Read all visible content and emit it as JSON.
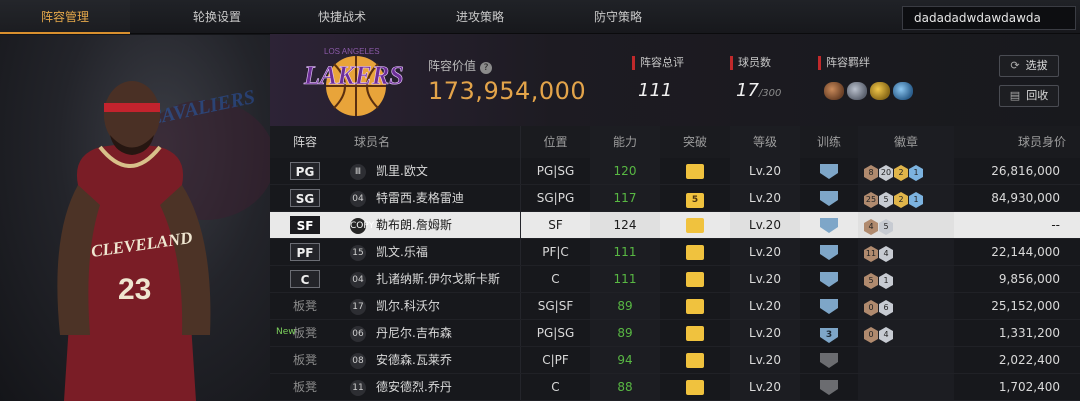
{
  "nav": {
    "tabs": [
      {
        "label": "阵容管理",
        "active": true
      },
      {
        "label": "轮换设置",
        "active": false
      },
      {
        "label": "快捷战术",
        "active": false
      },
      {
        "label": "进攻策略",
        "active": false
      },
      {
        "label": "防守策略",
        "active": false
      }
    ],
    "username": "dadadadwdawdawda"
  },
  "team": {
    "logo_text": "LAKERS",
    "logo_subtext": "LOS ANGELES",
    "value_label": "阵容价值",
    "value": "173,954,000",
    "overall_label": "阵容总评",
    "overall": "111",
    "players_label": "球员数",
    "players_count": "17",
    "players_max": "/300",
    "bond_label": "阵容羁绊",
    "buttons": {
      "select": "选拔",
      "recycle": "回收"
    }
  },
  "featured_player": {
    "team_text": "CLEVELAND",
    "jersey_number": "23",
    "bg_text": "CAVALIERS"
  },
  "table": {
    "headers": {
      "pos": "阵容",
      "name": "球员名",
      "role": "位置",
      "ability": "能力",
      "breakthrough": "突破",
      "level": "等级",
      "training": "训练",
      "badge": "徽章",
      "value": "球员身价"
    },
    "rows": [
      {
        "pos": "PG",
        "bench": false,
        "jersey": "Ⅲ",
        "name": "凯里.欧文",
        "role": "PG|SG",
        "ability": "120",
        "green": true,
        "brk": "",
        "level": "Lv.20",
        "train": "",
        "train_grey": false,
        "badges": [
          [
            "bronze",
            "8"
          ],
          [
            "silver",
            "20"
          ],
          [
            "gold",
            "2"
          ],
          [
            "blue",
            "1"
          ]
        ],
        "value": "26,816,000",
        "selected": false,
        "new": false
      },
      {
        "pos": "SG",
        "bench": false,
        "jersey": "04",
        "name": "特雷西.麦格雷迪",
        "role": "SG|PG",
        "ability": "117",
        "green": true,
        "brk": "5",
        "level": "Lv.20",
        "train": "",
        "train_grey": false,
        "badges": [
          [
            "bronze",
            "25"
          ],
          [
            "silver",
            "5"
          ],
          [
            "gold",
            "2"
          ],
          [
            "blue",
            "1"
          ]
        ],
        "value": "84,930,000",
        "selected": false,
        "new": false
      },
      {
        "pos": "SF",
        "bench": false,
        "jersey": "COPY",
        "name": "勒布朗.詹姆斯",
        "role": "SF",
        "ability": "124",
        "green": false,
        "brk": "",
        "level": "Lv.20",
        "train": "",
        "train_grey": false,
        "badges": [
          [
            "bronze",
            "4"
          ],
          [
            "silver",
            "5"
          ]
        ],
        "value": "--",
        "selected": true,
        "new": false
      },
      {
        "pos": "PF",
        "bench": false,
        "jersey": "15",
        "name": "凯文.乐福",
        "role": "PF|C",
        "ability": "111",
        "green": true,
        "brk": "",
        "level": "Lv.20",
        "train": "",
        "train_grey": false,
        "badges": [
          [
            "bronze",
            "11"
          ],
          [
            "silver",
            "4"
          ]
        ],
        "value": "22,144,000",
        "selected": false,
        "new": false
      },
      {
        "pos": "C",
        "bench": false,
        "jersey": "04",
        "name": "扎诸纳斯.伊尔戈斯卡斯",
        "role": "C",
        "ability": "111",
        "green": true,
        "brk": "",
        "level": "Lv.20",
        "train": "",
        "train_grey": false,
        "badges": [
          [
            "bronze",
            "5"
          ],
          [
            "silver",
            "1"
          ]
        ],
        "value": "9,856,000",
        "selected": false,
        "new": false
      },
      {
        "pos": "板凳",
        "bench": true,
        "jersey": "17",
        "name": "凯尔.科沃尔",
        "role": "SG|SF",
        "ability": "89",
        "green": true,
        "brk": "",
        "level": "Lv.20",
        "train": "",
        "train_grey": false,
        "badges": [
          [
            "bronze",
            "0"
          ],
          [
            "silver",
            "6"
          ]
        ],
        "value": "25,152,000",
        "selected": false,
        "new": false
      },
      {
        "pos": "板凳",
        "bench": true,
        "jersey": "06",
        "name": "丹尼尔.吉布森",
        "role": "PG|SG",
        "ability": "89",
        "green": true,
        "brk": "",
        "level": "Lv.20",
        "train": "3",
        "train_grey": false,
        "badges": [
          [
            "bronze",
            "0"
          ],
          [
            "silver",
            "4"
          ]
        ],
        "value": "1,331,200",
        "selected": false,
        "new": true
      },
      {
        "pos": "板凳",
        "bench": true,
        "jersey": "08",
        "name": "安德森.瓦莱乔",
        "role": "C|PF",
        "ability": "94",
        "green": true,
        "brk": "",
        "level": "Lv.20",
        "train": "",
        "train_grey": true,
        "badges": [],
        "value": "2,022,400",
        "selected": false,
        "new": false
      },
      {
        "pos": "板凳",
        "bench": true,
        "jersey": "11",
        "name": "德安德烈.乔丹",
        "role": "C",
        "ability": "88",
        "green": true,
        "brk": "",
        "level": "Lv.20",
        "train": "",
        "train_grey": true,
        "badges": [],
        "value": "1,702,400",
        "selected": false,
        "new": false
      }
    ],
    "new_tag": "New"
  }
}
